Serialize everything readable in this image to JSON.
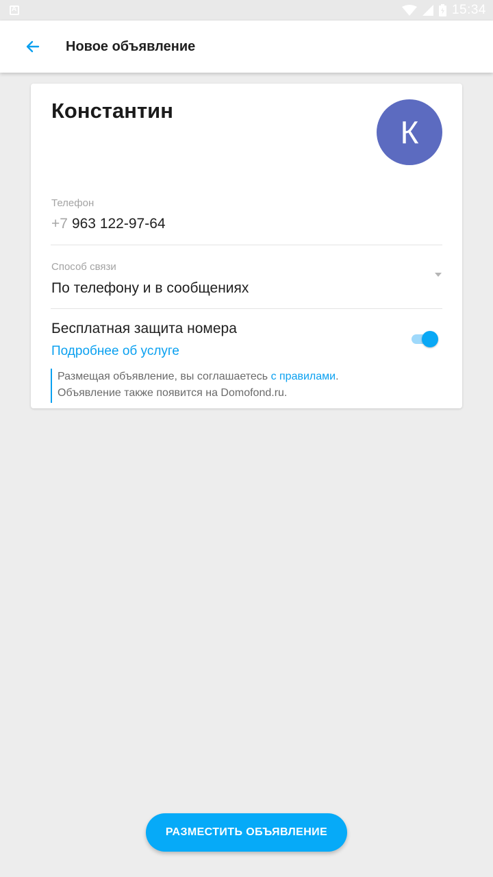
{
  "status_bar": {
    "time": "15:34",
    "icons": [
      "app-notification-icon",
      "wifi-icon",
      "signal-icon",
      "battery-icon"
    ]
  },
  "app_bar": {
    "title": "Новое объявление",
    "back_icon": "arrow-left-icon"
  },
  "profile": {
    "name": "Константин",
    "avatar_letter": "К",
    "avatar_color": "#5c6bc0"
  },
  "phone": {
    "label": "Телефон",
    "prefix": "+7",
    "number": "963 122-97-64"
  },
  "contact_method": {
    "label": "Способ связи",
    "value": "По телефону и в сообщениях"
  },
  "protection": {
    "title": "Бесплатная защита номера",
    "link": "Подробнее об услуге",
    "enabled": true
  },
  "notice": {
    "line1_text": "Размещая объявление, вы соглашаетесь ",
    "line1_link": "с правилами",
    "line1_end": ".",
    "line2": "Объявление также появится на Domofond.ru."
  },
  "submit_button": {
    "label": "РАЗМЕСТИТЬ ОБЪЯВЛЕНИЕ"
  },
  "colors": {
    "accent": "#06aaf8",
    "link": "#0aa0f0",
    "background": "#ededed"
  }
}
